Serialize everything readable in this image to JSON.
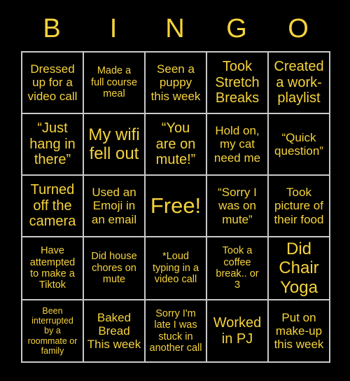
{
  "card": {
    "title_letters": [
      "B",
      "I",
      "N",
      "G",
      "O"
    ],
    "accent_color": "#F5D33C",
    "background_color": "#000000",
    "grid_line_color": "#C9C9C9",
    "rows": 5,
    "columns": 5,
    "cells": [
      {
        "text": "Dressed\nup for a\nvideo call",
        "size": "md",
        "free": false
      },
      {
        "text": "Made a\nfull course\nmeal",
        "size": "sm",
        "free": false
      },
      {
        "text": "Seen a\npuppy\nthis week",
        "size": "md",
        "free": false
      },
      {
        "text": "Took\nStretch\nBreaks",
        "size": "lg",
        "free": false
      },
      {
        "text": "Created\na work-\nplaylist",
        "size": "lg",
        "free": false
      },
      {
        "text": "“Just\nhang in\nthere”",
        "size": "lg",
        "free": false
      },
      {
        "text": "My wifi\nfell out",
        "size": "xl",
        "free": false
      },
      {
        "text": "“You\nare on\nmute!”",
        "size": "lg",
        "free": false
      },
      {
        "text": "Hold on,\nmy cat\nneed me",
        "size": "md",
        "free": false
      },
      {
        "text": "“Quick\nquestion”",
        "size": "md",
        "free": false
      },
      {
        "text": "Turned\noff the\ncamera",
        "size": "lg",
        "free": false
      },
      {
        "text": "Used an\nEmoji in\nan email",
        "size": "md",
        "free": false
      },
      {
        "text": "Free!",
        "size": "free",
        "free": true
      },
      {
        "text": "“Sorry I\nwas on\nmute”",
        "size": "md",
        "free": false
      },
      {
        "text": "Took\npicture of\ntheir food",
        "size": "md",
        "free": false
      },
      {
        "text": "Have\nattempted\nto make a\nTiktok",
        "size": "sm",
        "free": false
      },
      {
        "text": "Did house\nchores on\nmute",
        "size": "sm",
        "free": false
      },
      {
        "text": "*Loud\ntyping in a\nvideo call",
        "size": "sm",
        "free": false
      },
      {
        "text": "Took a\ncoffee\nbreak.. or\n3",
        "size": "sm",
        "free": false
      },
      {
        "text": "Did\nChair\nYoga",
        "size": "xl",
        "free": false
      },
      {
        "text": "Been\ninterrupted\nby a\nroommate or\nfamily",
        "size": "xs",
        "free": false
      },
      {
        "text": "Baked\nBread\nThis week",
        "size": "md",
        "free": false
      },
      {
        "text": "Sorry I'm\nlate I was\nstuck in\nanother call",
        "size": "sm",
        "free": false
      },
      {
        "text": "Worked\nin PJ",
        "size": "lg",
        "free": false
      },
      {
        "text": "Put on\nmake-up\nthis week",
        "size": "md",
        "free": false
      }
    ]
  }
}
